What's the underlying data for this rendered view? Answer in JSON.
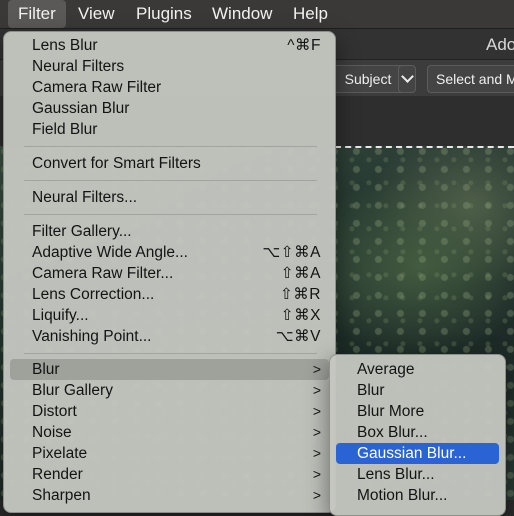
{
  "menubar": {
    "items": [
      "Filter",
      "View",
      "Plugins",
      "Window",
      "Help"
    ]
  },
  "app": {
    "title": "Ado",
    "toolbar": {
      "subject_label": "Subject",
      "dropdown_icon": "chevron-down-icon",
      "select_mask_label": "Select and Ma"
    }
  },
  "filter_menu": {
    "items": [
      {
        "label": "Lens Blur",
        "shortcut": "^⌘F"
      },
      {
        "label": "Neural Filters",
        "shortcut": ""
      },
      {
        "label": "Camera Raw Filter",
        "shortcut": ""
      },
      {
        "label": "Gaussian Blur",
        "shortcut": ""
      },
      {
        "label": "Field Blur",
        "shortcut": ""
      },
      {
        "label": "Convert for Smart Filters",
        "shortcut": ""
      },
      {
        "label": "Neural Filters...",
        "shortcut": ""
      },
      {
        "label": "Filter Gallery...",
        "shortcut": ""
      },
      {
        "label": "Adaptive Wide Angle...",
        "shortcut": "⌥⇧⌘A"
      },
      {
        "label": "Camera Raw Filter...",
        "shortcut": "⇧⌘A"
      },
      {
        "label": "Lens Correction...",
        "shortcut": "⇧⌘R"
      },
      {
        "label": "Liquify...",
        "shortcut": "⇧⌘X"
      },
      {
        "label": "Vanishing Point...",
        "shortcut": "⌥⌘V"
      },
      {
        "label": "Blur",
        "submenu": true
      },
      {
        "label": "Blur Gallery",
        "submenu": true
      },
      {
        "label": "Distort",
        "submenu": true
      },
      {
        "label": "Noise",
        "submenu": true
      },
      {
        "label": "Pixelate",
        "submenu": true
      },
      {
        "label": "Render",
        "submenu": true
      },
      {
        "label": "Sharpen",
        "submenu": true
      }
    ],
    "highlighted": "Blur"
  },
  "blur_submenu": {
    "items": [
      "Average",
      "Blur",
      "Blur More",
      "Box Blur...",
      "Gaussian Blur...",
      "Lens Blur...",
      "Motion Blur..."
    ],
    "selected": "Gaussian Blur..."
  },
  "colors": {
    "menu_bg": "#c4c6c0",
    "selection": "#2a64d4",
    "menubar_bg": "#3a3938"
  }
}
